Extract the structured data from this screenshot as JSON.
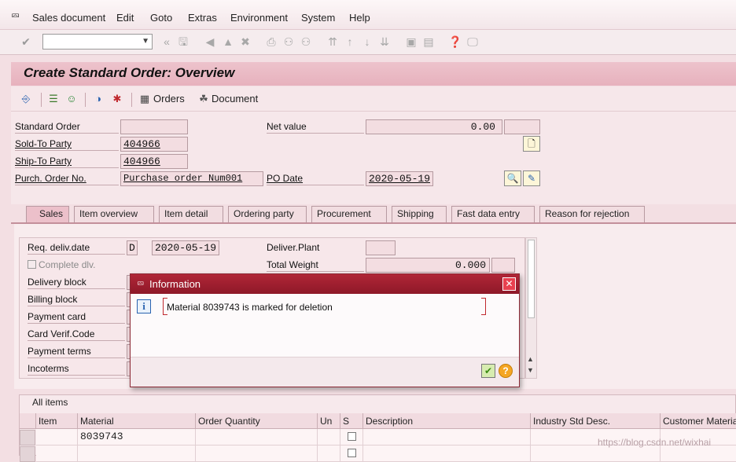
{
  "menu": [
    "Sales document",
    "Edit",
    "Goto",
    "Extras",
    "Environment",
    "System",
    "Help"
  ],
  "title": "Create Standard Order: Overview",
  "app_toolbar": {
    "orders": "Orders",
    "document": "Document"
  },
  "header": {
    "standard_order_label": "Standard Order",
    "standard_order_value": "",
    "sold_to_label": "Sold-To Party",
    "sold_to_value": "404966",
    "ship_to_label": "Ship-To Party",
    "ship_to_value": "404966",
    "po_label": "Purch. Order No.",
    "po_value": "Purchase order Num001",
    "net_value_label": "Net value",
    "net_value": "0.00",
    "po_date_label": "PO Date",
    "po_date_value": "2020-05-19"
  },
  "tabs": [
    "Sales",
    "Item overview",
    "Item detail",
    "Ordering party",
    "Procurement",
    "Shipping",
    "Fast data entry",
    "Reason for rejection"
  ],
  "sales_tab": {
    "req_deliv_label": "Req. deliv.date",
    "req_deliv_type": "D",
    "req_deliv_value": "2020-05-19",
    "complete_dlv_label": "Complete dlv.",
    "delivery_block_label": "Delivery block",
    "billing_block_label": "Billing block",
    "payment_card_label": "Payment card",
    "card_verif_label": "Card Verif.Code",
    "payment_terms_label": "Payment terms",
    "incoterms_label": "Incoterms",
    "deliver_plant_label": "Deliver.Plant",
    "total_weight_label": "Total Weight",
    "total_weight_value": "0.000"
  },
  "dialog": {
    "title": "Information",
    "message": "Material 8039743 is marked for deletion"
  },
  "items": {
    "title": "All items",
    "columns": [
      "Item",
      "Material",
      "Order Quantity",
      "Un",
      "S",
      "Description",
      "Industry Std Desc.",
      "Customer Materia"
    ],
    "rows": [
      {
        "item": "",
        "material": "8039743",
        "qty": "",
        "un": "",
        "description": "",
        "industry": "",
        "customer": ""
      },
      {
        "item": "",
        "material": "",
        "qty": "",
        "un": "",
        "description": "",
        "industry": "",
        "customer": ""
      }
    ]
  },
  "watermark": "https://blog.csdn.net/wixhai",
  "colors": {
    "title_bg": "#e7b1bd",
    "dialog_title": "#a0202f",
    "ok_button": "#7fbf2f",
    "help_button": "#f5a623"
  }
}
